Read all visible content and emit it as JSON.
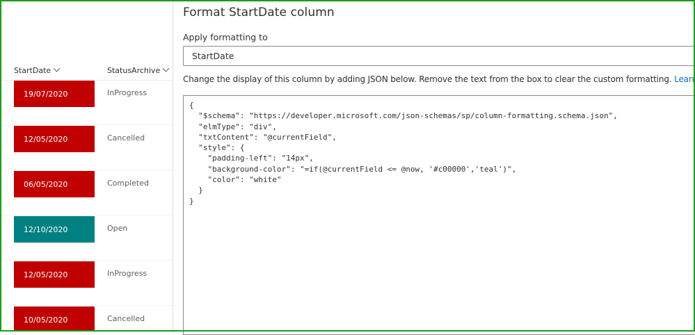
{
  "list": {
    "columns": {
      "start_date": "StartDate",
      "status": "StatusArchive"
    },
    "rows": [
      {
        "date": "19/07/2020",
        "status": "InProgress",
        "color": "#c00000"
      },
      {
        "date": "12/05/2020",
        "status": "Cancelled",
        "color": "#c00000"
      },
      {
        "date": "06/05/2020",
        "status": "Completed",
        "color": "#c00000"
      },
      {
        "date": "12/10/2020",
        "status": "Open",
        "color": "#008080"
      },
      {
        "date": "12/05/2020",
        "status": "InProgress",
        "color": "#c00000"
      },
      {
        "date": "10/05/2020",
        "status": "Cancelled",
        "color": "#c00000"
      }
    ]
  },
  "panel": {
    "title": "Format StartDate column",
    "apply_label": "Apply formatting to",
    "apply_value": "StartDate",
    "description": "Change the display of this column by adding JSON below. Remove the text from the box to clear the custom formatting.",
    "learn_more": "Learn more",
    "json_text": "{\n  \"$schema\": \"https://developer.microsoft.com/json-schemas/sp/column-formatting.schema.json\",\n  \"elmType\": \"div\",\n  \"txtContent\": \"@currentField\",\n  \"style\": {\n    \"padding-left\": \"14px\",\n    \"background-color\": \"=if(@currentField <= @now, '#c00000','teal')\",\n    \"color\": \"white\"\n  }\n}"
  },
  "colors": {
    "frame": "#1a9b1a",
    "past": "#c00000",
    "future": "#008080",
    "link": "#0f6cbd"
  }
}
